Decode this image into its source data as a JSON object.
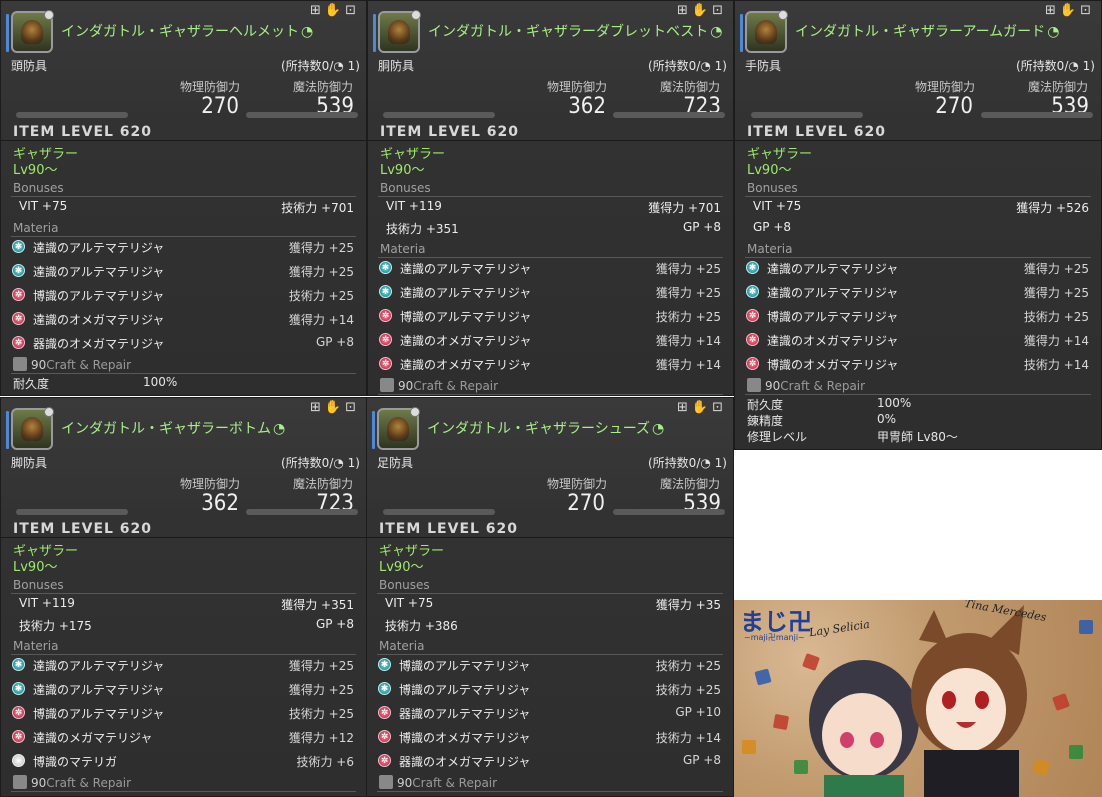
{
  "panels": [
    {
      "name": "インダガトル・ギャザラーヘルメット",
      "category": "頭防具",
      "owned": "(所持数0/",
      "owned_tail": " 1)",
      "phys_label": "物理防御力",
      "phys_val": "270",
      "mag_label": "魔法防御力",
      "mag_val": "539",
      "item_level": "ITEM LEVEL 620",
      "job": "ギャザラー",
      "level": "Lv90〜",
      "bonuses_label": "Bonuses",
      "bonuses": [
        {
          "l": "VIT +75",
          "r": "技術力 +701"
        }
      ],
      "materia_label": "Materia",
      "materia": [
        {
          "color": "teal",
          "name": "達識のアルテマテリジャ",
          "val": "獲得力 +25"
        },
        {
          "color": "teal",
          "name": "達識のアルテマテリジャ",
          "val": "獲得力 +25"
        },
        {
          "color": "red",
          "name": "博識のアルテマテリジャ",
          "val": "技術力 +25"
        },
        {
          "color": "red",
          "name": "達識のオメガマテリジャ",
          "val": "獲得力 +14"
        },
        {
          "color": "red",
          "name": "器識のオメガマテリジャ",
          "val": "GP +8"
        }
      ],
      "craft_num": "90",
      "craft_label": "Craft & Repair",
      "extra": [
        {
          "k": "耐久度",
          "v": "100%"
        }
      ]
    },
    {
      "name": "インダガトル・ギャザラーダブレットベスト",
      "category": "胴防具",
      "owned": "(所持数0/",
      "owned_tail": " 1)",
      "phys_label": "物理防御力",
      "phys_val": "362",
      "mag_label": "魔法防御力",
      "mag_val": "723",
      "item_level": "ITEM LEVEL 620",
      "job": "ギャザラー",
      "level": "Lv90〜",
      "bonuses_label": "Bonuses",
      "bonuses": [
        {
          "l": "VIT +119",
          "r": "獲得力 +701"
        },
        {
          "l": "技術力 +351",
          "r": "GP +8"
        }
      ],
      "materia_label": "Materia",
      "materia": [
        {
          "color": "teal",
          "name": "達識のアルテマテリジャ",
          "val": "獲得力 +25"
        },
        {
          "color": "teal",
          "name": "達識のアルテマテリジャ",
          "val": "獲得力 +25"
        },
        {
          "color": "red",
          "name": "博識のアルテマテリジャ",
          "val": "技術力 +25"
        },
        {
          "color": "red",
          "name": "達識のオメガマテリジャ",
          "val": "獲得力 +14"
        },
        {
          "color": "red",
          "name": "達識のオメガマテリジャ",
          "val": "獲得力 +14"
        }
      ],
      "craft_num": "90",
      "craft_label": "Craft & Repair",
      "extra": []
    },
    {
      "name": "インダガトル・ギャザラーアームガード",
      "category": "手防具",
      "owned": "(所持数0/",
      "owned_tail": " 1)",
      "phys_label": "物理防御力",
      "phys_val": "270",
      "mag_label": "魔法防御力",
      "mag_val": "539",
      "item_level": "ITEM LEVEL 620",
      "job": "ギャザラー",
      "level": "Lv90〜",
      "bonuses_label": "Bonuses",
      "bonuses": [
        {
          "l": "VIT +75",
          "r": "獲得力 +526"
        },
        {
          "l": "GP +8",
          "r": ""
        }
      ],
      "materia_label": "Materia",
      "materia": [
        {
          "color": "teal",
          "name": "達識のアルテマテリジャ",
          "val": "獲得力 +25"
        },
        {
          "color": "teal",
          "name": "達識のアルテマテリジャ",
          "val": "獲得力 +25"
        },
        {
          "color": "red",
          "name": "博識のアルテマテリジャ",
          "val": "技術力 +25"
        },
        {
          "color": "red",
          "name": "達識のオメガマテリジャ",
          "val": "獲得力 +14"
        },
        {
          "color": "red",
          "name": "博識のオメガマテリジャ",
          "val": "技術力 +14"
        }
      ],
      "craft_num": "90",
      "craft_label": "Craft & Repair",
      "extra": [
        {
          "k": "耐久度",
          "v": "100%"
        },
        {
          "k": "錬精度",
          "v": "0%"
        },
        {
          "k": "修理レベル",
          "v": "甲冑師 Lv80〜"
        }
      ]
    },
    {
      "name": "インダガトル・ギャザラーボトム",
      "category": "脚防具",
      "owned": "(所持数0/",
      "owned_tail": " 1)",
      "phys_label": "物理防御力",
      "phys_val": "362",
      "mag_label": "魔法防御力",
      "mag_val": "723",
      "item_level": "ITEM LEVEL 620",
      "job": "ギャザラー",
      "level": "Lv90〜",
      "bonuses_label": "Bonuses",
      "bonuses": [
        {
          "l": "VIT +119",
          "r": "獲得力 +351"
        },
        {
          "l": "技術力 +175",
          "r": "GP +8"
        }
      ],
      "materia_label": "Materia",
      "materia": [
        {
          "color": "teal",
          "name": "達識のアルテマテリジャ",
          "val": "獲得力 +25"
        },
        {
          "color": "teal",
          "name": "達識のアルテマテリジャ",
          "val": "獲得力 +25"
        },
        {
          "color": "red",
          "name": "博識のアルテマテリジャ",
          "val": "技術力 +25"
        },
        {
          "color": "red",
          "name": "達識のメガマテリジャ",
          "val": "獲得力 +12"
        },
        {
          "color": "white",
          "name": "博識のマテリガ",
          "val": "技術力 +6"
        }
      ],
      "craft_num": "90",
      "craft_label": "Craft & Repair",
      "extra": []
    },
    {
      "name": "インダガトル・ギャザラーシューズ",
      "category": "足防具",
      "owned": "(所持数0/",
      "owned_tail": " 1)",
      "phys_label": "物理防御力",
      "phys_val": "270",
      "mag_label": "魔法防御力",
      "mag_val": "539",
      "item_level": "ITEM LEVEL 620",
      "job": "ギャザラー",
      "level": "Lv90〜",
      "bonuses_label": "Bonuses",
      "bonuses": [
        {
          "l": "VIT +75",
          "r": "獲得力 +35"
        },
        {
          "l": "技術力 +386",
          "r": ""
        }
      ],
      "materia_label": "Materia",
      "materia": [
        {
          "color": "teal",
          "name": "博識のアルテマテリジャ",
          "val": "技術力 +25"
        },
        {
          "color": "teal",
          "name": "博識のアルテマテリジャ",
          "val": "技術力 +25"
        },
        {
          "color": "red",
          "name": "器識のアルテマテリジャ",
          "val": "GP +10"
        },
        {
          "color": "red",
          "name": "博識のオメガマテリジャ",
          "val": "技術力 +14"
        },
        {
          "color": "red",
          "name": "器識のオメガマテリジャ",
          "val": "GP +8"
        }
      ],
      "craft_num": "90",
      "craft_label": "Craft & Repair",
      "extra": []
    }
  ],
  "art": {
    "logo": "まじ卍",
    "logo_sub": "~maji卍manji~",
    "name_left": "Lay Selicia",
    "name_right": "Tina Mercedes"
  }
}
